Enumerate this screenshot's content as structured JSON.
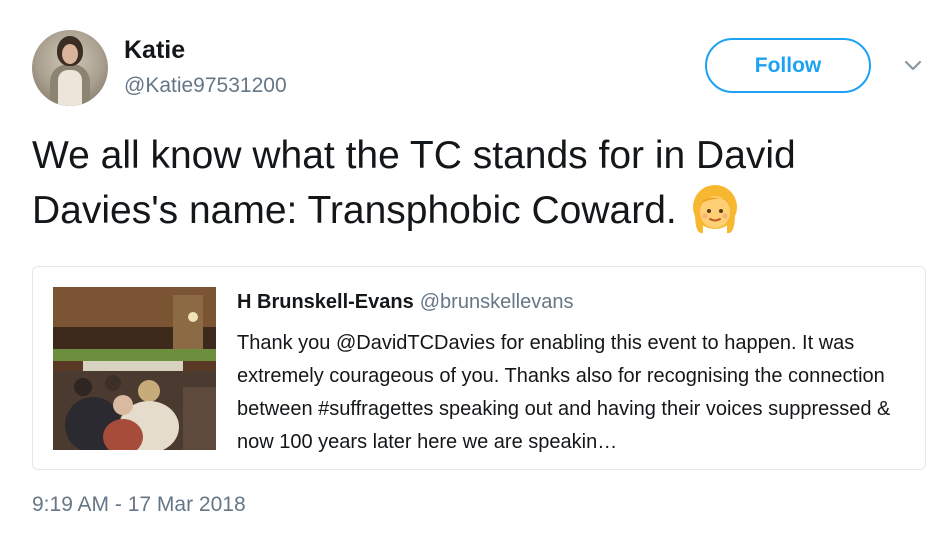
{
  "user": {
    "display_name": "Katie",
    "handle": "@Katie97531200"
  },
  "follow_label": "Follow",
  "tweet": {
    "text": "We all know what the TC stands for in David Davies's name: Transphobic Coward.",
    "emoji_icon": "woman-blond-emoji-icon"
  },
  "quoted_tweet": {
    "display_name": "H Brunskell-Evans",
    "handle": "@brunskellevans",
    "text": "Thank you @DavidTCDavies for enabling this event to happen. It was extremely courageous of you. Thanks also for recognising the connection between #suffragettes speaking out and having their voices suppressed & now 100 years later here we are speakin…"
  },
  "timestamp": "9:19 AM - 17 Mar 2018",
  "colors": {
    "accent": "#1da1f2",
    "text_primary": "#14171a",
    "text_secondary": "#657786",
    "border": "#e1e8ed"
  }
}
